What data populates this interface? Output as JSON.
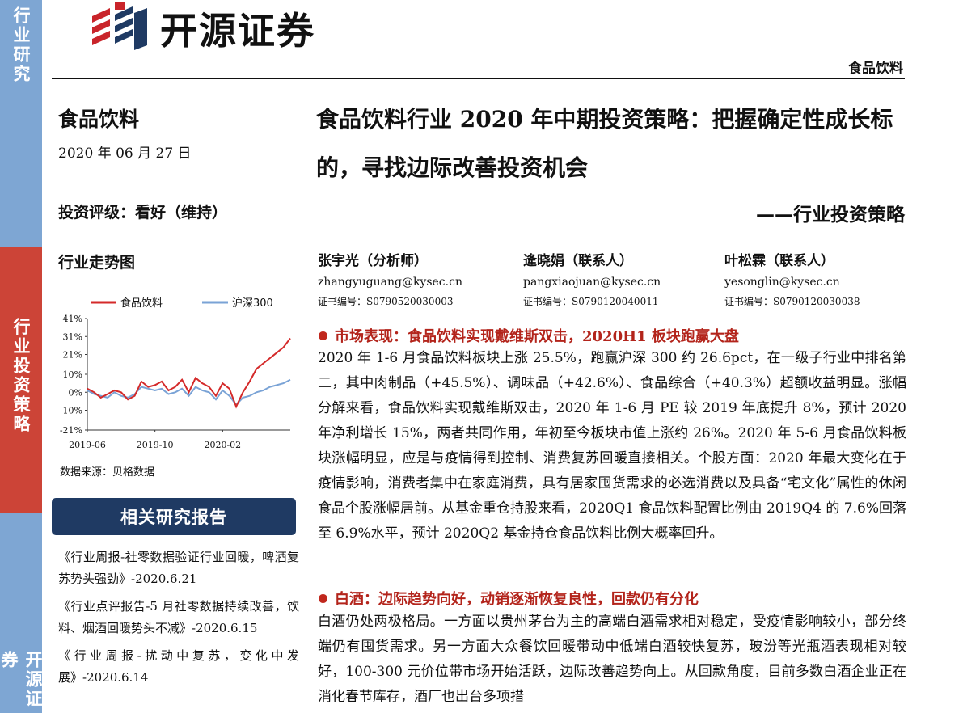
{
  "sidebar": {
    "top": "行业研究",
    "middle": "行业投资策略",
    "bottom": "开源证券"
  },
  "logo": {
    "text": "开源证券"
  },
  "header": {
    "category": "食品饮料"
  },
  "left": {
    "title": "食品饮料",
    "date": "2020 年 06 月 27 日",
    "rating": "投资评级：看好（维持）",
    "trend_title": "行业走势图",
    "source": "数据来源：贝格数据",
    "related_header": "相关研究报告",
    "reports": [
      "《行业周报-社零数据验证行业回暖，啤酒复苏势头强劲》-2020.6.21",
      "《行业点评报告-5 月社零数据持续改善，饮料、烟酒回暖势头不减》-2020.6.15",
      "《行业周报-扰动中复苏，变化中发展》-2020.6.14"
    ]
  },
  "main": {
    "title": "食品饮料行业 2020 年中期投资策略：把握确定性成长标的，寻找边际改善投资机会",
    "subtitle": "——行业投资策略",
    "analysts": [
      {
        "name": "张宇光（分析师）",
        "email": "zhangyuguang@kysec.cn",
        "cert": "证书编号：S0790520030003"
      },
      {
        "name": "逄晓娟（联系人）",
        "email": "pangxiaojuan@kysec.cn",
        "cert": "证书编号：S0790120040011"
      },
      {
        "name": "叶松霖（联系人）",
        "email": "yesonglin@kysec.cn",
        "cert": "证书编号：S0790120030038"
      }
    ],
    "sections": [
      {
        "heading": "市场表现：食品饮料实现戴维斯双击，2020H1 板块跑赢大盘",
        "body": "2020 年 1-6 月食品饮料板块上涨 25.5%，跑赢沪深 300 约 26.6pct，在一级子行业中排名第二，其中肉制品（+45.5%）、调味品（+42.6%）、食品综合（+40.3%）超额收益明显。涨幅分解来看，食品饮料实现戴维斯双击，2020 年 1-6 月 PE 较 2019 年底提升 8%，预计 2020 年净利增长 15%，两者共同作用，年初至今板块市值上涨约 26%。2020 年 5-6 月食品饮料板块涨幅明显，应是与疫情得到控制、消费复苏回暖直接相关。个股方面：2020 年最大变化在于疫情影响，消费者集中在家庭消费，具有居家囤货需求的必选消费以及具备“宅文化”属性的休闲食品个股涨幅居前。从基金重仓持股来看，2020Q1 食品饮料配置比例由 2019Q4 的 7.6%回落至 6.9%水平，预计 2020Q2 基金持仓食品饮料比例大概率回升。"
      },
      {
        "heading": "白酒：边际趋势向好，动销逐渐恢复良性，回款仍有分化",
        "body": "白酒仍处两极格局。一方面以贵州茅台为主的高端白酒需求相对稳定，受疫情影响较小，部分终端仍有囤货需求。另一方面大众餐饮回暖带动中低端白酒较快复苏，玻汾等光瓶酒表现相对较好，100-300 元价位带市场开始活跃，边际改善趋势向上。从回款角度，目前多数白酒企业正在消化春节库存，酒厂也出台多项措"
      }
    ]
  },
  "chart_data": {
    "type": "line",
    "title": "",
    "xlabel": "",
    "ylabel": "",
    "y_ticks": [
      "41%",
      "31%",
      "21%",
      "10%",
      "0%",
      "-10%",
      "-21%"
    ],
    "y_tick_values": [
      41,
      31,
      21,
      10,
      0,
      -10,
      -21
    ],
    "ylim": [
      -21,
      41
    ],
    "x_ticks": [
      "2019-06",
      "2019-10",
      "2020-02"
    ],
    "x_tick_values": [
      0,
      4,
      8
    ],
    "xlim": [
      0,
      12
    ],
    "legend_position": "top",
    "grid": false,
    "series": [
      {
        "name": "食品饮料",
        "color": "#d42a2a",
        "x": [
          0,
          0.4,
          0.8,
          1.2,
          1.6,
          2,
          2.4,
          2.8,
          3.2,
          3.6,
          4,
          4.4,
          4.8,
          5.2,
          5.6,
          6,
          6.4,
          6.8,
          7.2,
          7.6,
          8,
          8.4,
          8.8,
          9.2,
          9.6,
          10,
          10.4,
          10.8,
          11.2,
          11.6,
          12
        ],
        "y": [
          2,
          0,
          -3,
          -1,
          1,
          0,
          -4,
          -2,
          6,
          3,
          4,
          6,
          1,
          3,
          7,
          0,
          8,
          5,
          3,
          -2,
          5,
          2,
          -8,
          0,
          6,
          13,
          16,
          19,
          22,
          25,
          30
        ]
      },
      {
        "name": "沪深300",
        "color": "#7aa3d6",
        "x": [
          0,
          0.4,
          0.8,
          1.2,
          1.6,
          2,
          2.4,
          2.8,
          3.2,
          3.6,
          4,
          4.4,
          4.8,
          5.2,
          5.6,
          6,
          6.4,
          6.8,
          7.2,
          7.6,
          8,
          8.4,
          8.8,
          9.2,
          9.6,
          10,
          10.4,
          10.8,
          11.2,
          11.6,
          12
        ],
        "y": [
          1,
          -1,
          -2,
          -3,
          0,
          -2,
          -3,
          -1,
          3,
          2,
          1,
          2,
          -1,
          0,
          2,
          -2,
          3,
          1,
          0,
          -4,
          1,
          -2,
          -7,
          -3,
          -2,
          0,
          1,
          3,
          4,
          5,
          7
        ]
      }
    ]
  }
}
